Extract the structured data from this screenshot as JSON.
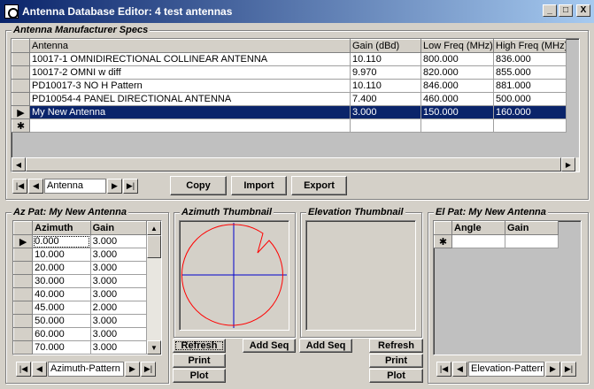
{
  "window": {
    "title": "Antenna Database Editor: 4 test antennas",
    "controls": [
      "_",
      "□",
      "X"
    ]
  },
  "specs": {
    "label": "Antenna Manufacturer Specs",
    "columns": [
      "Antenna",
      "Gain (dBd)",
      "Low Freq (MHz)",
      "High Freq (MHz)"
    ],
    "rows": [
      {
        "indicator": "",
        "cells": [
          "10017-1 OMNIDIRECTIONAL COLLINEAR ANTENNA",
          "10.110",
          "800.000",
          "836.000"
        ]
      },
      {
        "indicator": "",
        "cells": [
          "10017-2 OMNI w diff",
          "9.970",
          "820.000",
          "855.000"
        ]
      },
      {
        "indicator": "",
        "cells": [
          "PD10017-3 NO H Pattern",
          "10.110",
          "846.000",
          "881.000"
        ]
      },
      {
        "indicator": "",
        "cells": [
          "PD10054-4 PANEL DIRECTIONAL ANTENNA",
          "7.400",
          "460.000",
          "500.000"
        ]
      },
      {
        "indicator": "▶",
        "cells": [
          "My New Antenna",
          "3.000",
          "150.000",
          "160.000"
        ]
      }
    ],
    "new_row_indicator": "✱",
    "nav_label": "Antenna",
    "buttons": {
      "copy": "Copy",
      "import": "Import",
      "export": "Export"
    }
  },
  "az_pat": {
    "label": "Az Pat: My New Antenna",
    "columns": [
      "Azimuth",
      "Gain"
    ],
    "rows": [
      [
        "0.000",
        "3.000"
      ],
      [
        "10.000",
        "3.000"
      ],
      [
        "20.000",
        "3.000"
      ],
      [
        "30.000",
        "3.000"
      ],
      [
        "40.000",
        "3.000"
      ],
      [
        "45.000",
        "2.000"
      ],
      [
        "50.000",
        "3.000"
      ],
      [
        "60.000",
        "3.000"
      ],
      [
        "70.000",
        "3.000"
      ]
    ],
    "current_indicator": "▶",
    "nav_label": "Azimuth-Pattern"
  },
  "az_thumb": {
    "label": "Azimuth Thumbnail",
    "buttons": {
      "refresh": "Refresh",
      "print": "Print",
      "plot": "Plot",
      "add_seq": "Add Seq"
    },
    "colors": {
      "pattern": "#ff0000",
      "axes": "#0000cc"
    }
  },
  "el_thumb": {
    "label": "Elevation Thumbnail",
    "buttons": {
      "add_seq": "Add Seq",
      "refresh": "Refresh",
      "print": "Print",
      "plot": "Plot"
    }
  },
  "el_pat": {
    "label": "El Pat: My New Antenna",
    "columns": [
      "Angle",
      "Gain"
    ],
    "new_row_indicator": "✱",
    "nav_label": "Elevation-Pattern"
  },
  "nav_glyphs": {
    "first": "|◀",
    "prev": "◀",
    "next": "▶",
    "last": "▶|"
  }
}
